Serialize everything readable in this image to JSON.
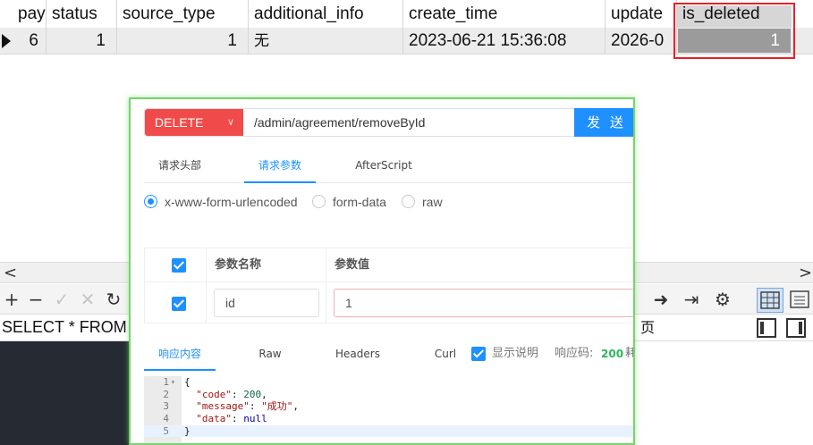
{
  "grid": {
    "columns": [
      "pay",
      "status",
      "source_type",
      "additional_info",
      "create_time",
      "update",
      "is_deleted"
    ],
    "row": {
      "pay": "6",
      "status": "1",
      "source_type": "1",
      "additional_info": "无",
      "create_time": "2023-06-21 15:36:08",
      "update": "2026-0",
      "is_deleted": "1"
    }
  },
  "scrollbar": {
    "left_arrow": "<",
    "right_arrow": ">"
  },
  "toolbar": {
    "add": "+",
    "remove": "−",
    "apply": "✓",
    "cancel": "✕",
    "refresh": "↻",
    "next": "➜",
    "last": "⇥",
    "settings": "⚙"
  },
  "sql_bar": {
    "query_text": "SELECT * FROM `",
    "page_label": "页"
  },
  "request": {
    "method": "DELETE",
    "url": "/admin/agreement/removeById",
    "send_label": "发 送",
    "tabs": [
      "请求头部",
      "请求参数",
      "AfterScript"
    ],
    "active_tab": "请求参数",
    "body_types": [
      "x-www-form-urlencoded",
      "form-data",
      "raw"
    ],
    "selected_body_type": "x-www-form-urlencoded",
    "params_table": {
      "header_name": "参数名称",
      "header_value": "参数值",
      "rows": [
        {
          "name": "id",
          "value": "1",
          "checked": true
        }
      ]
    }
  },
  "response": {
    "tabs": [
      "响应内容",
      "Raw",
      "Headers",
      "Curl"
    ],
    "active_tab": "响应内容",
    "show_desc_label": "显示说明",
    "status_label": "响应码:",
    "status_code": "200",
    "trailing": "耗",
    "code_lines": [
      {
        "n": "1",
        "text": "{"
      },
      {
        "n": "2",
        "key": "\"code\"",
        "val": "200",
        "type": "num"
      },
      {
        "n": "3",
        "key": "\"message\"",
        "val": "\"成功\"",
        "type": "str"
      },
      {
        "n": "4",
        "key": "\"data\"",
        "val": "null",
        "type": "null"
      },
      {
        "n": "5",
        "text": "}"
      }
    ]
  },
  "colors": {
    "delete_method": "#f14a4a",
    "send_button": "#1e90ff",
    "dialog_border": "#76d46b",
    "highlight": "#e8202a",
    "status_ok": "#2db55d"
  }
}
